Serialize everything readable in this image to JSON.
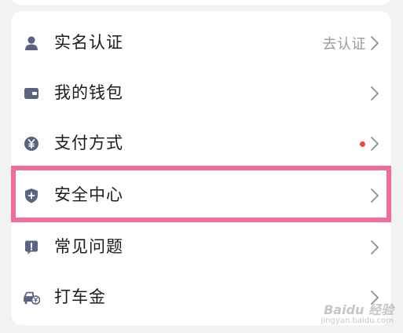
{
  "menu": {
    "items": [
      {
        "label": "实名认证",
        "status": "去认证",
        "icon": "user-icon"
      },
      {
        "label": "我的钱包",
        "icon": "wallet-icon"
      },
      {
        "label": "支付方式",
        "icon": "yuan-coin-icon",
        "badge": "red-dot"
      },
      {
        "label": "安全中心",
        "icon": "shield-plus-icon",
        "highlighted": true
      },
      {
        "label": "常见问题",
        "icon": "exclamation-chat-icon"
      },
      {
        "label": "打车金",
        "icon": "car-yuan-icon"
      }
    ]
  },
  "watermark": {
    "brand": "Baidu 经验",
    "site": "jingyan.baidu.com"
  },
  "colors": {
    "icon": "#5c6380",
    "text": "#1c1c1e",
    "status": "#9a9aa0",
    "badge": "#f0453a",
    "highlight": "#f06d95",
    "background": "#f2f2f4"
  }
}
